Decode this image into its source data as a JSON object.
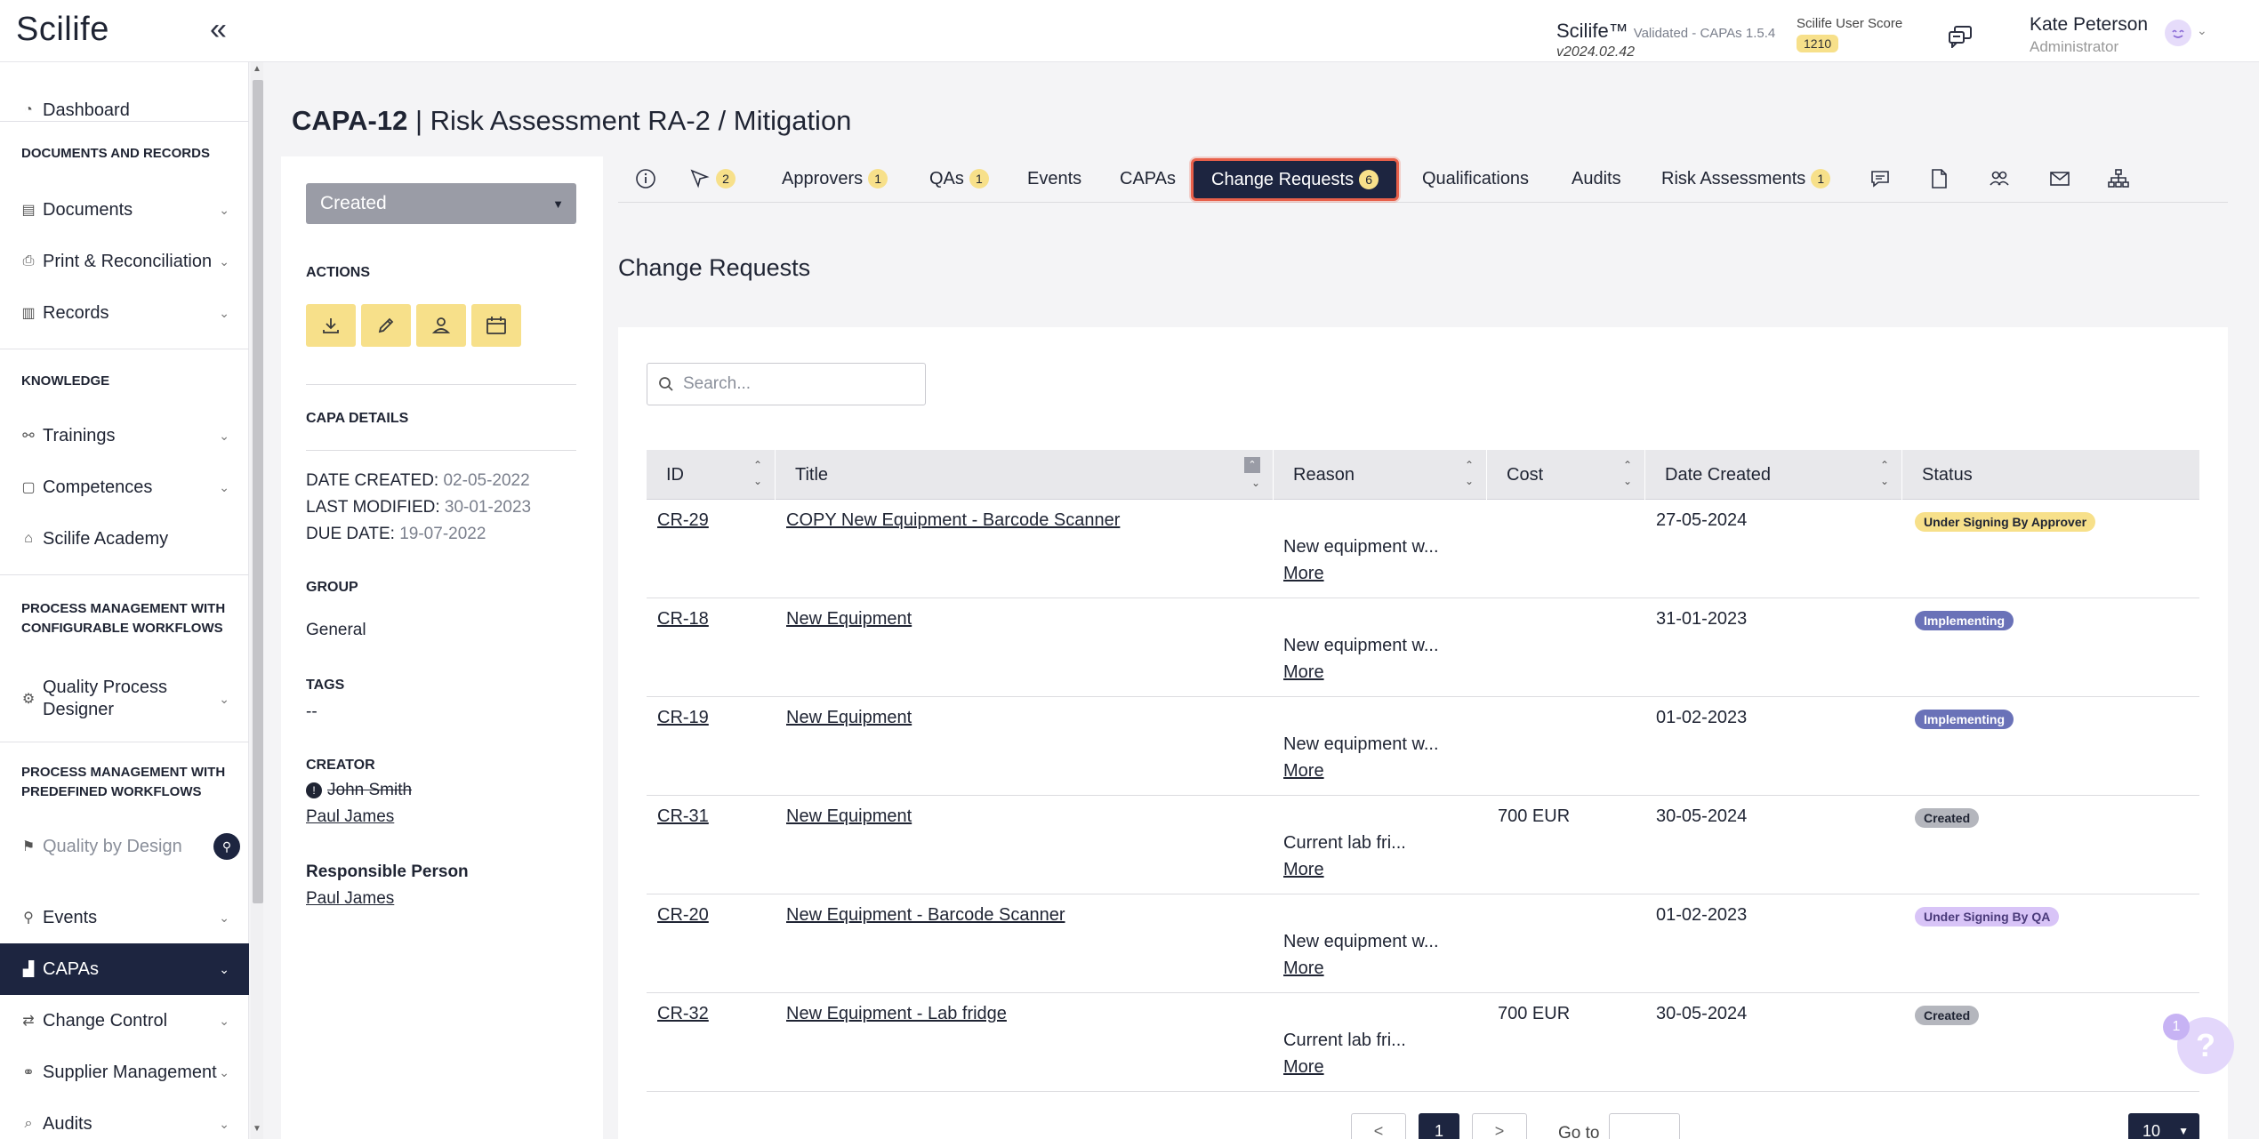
{
  "header": {
    "logo": "Scilife",
    "collapse_icon": "double-chevron-left-icon",
    "app_name": "Scilife™",
    "app_validated": "Validated - CAPAs 1.5.4",
    "app_version": "v2024.02.42",
    "score_label": "Scilife User Score",
    "score_value": "1210",
    "chat_icon": "chat-icon",
    "user_name": "Kate Peterson",
    "user_role": "Administrator"
  },
  "sidebar": {
    "dashboard": "Dashboard",
    "section_docs": "DOCUMENTS AND RECORDS",
    "documents": "Documents",
    "print_reconciliation": "Print & Reconciliation",
    "records": "Records",
    "section_knowledge": "KNOWLEDGE",
    "trainings": "Trainings",
    "competences": "Competences",
    "academy": "Scilife Academy",
    "section_configurable": "PROCESS MANAGEMENT WITH CONFIGURABLE WORKFLOWS",
    "quality_process_designer": "Quality Process Designer",
    "section_predefined": "PROCESS MANAGEMENT WITH PREDEFINED WORKFLOWS",
    "quality_by_design": "Quality by Design",
    "events": "Events",
    "capas": "CAPAs",
    "change_control": "Change Control",
    "supplier_management": "Supplier Management",
    "audits": "Audits"
  },
  "page": {
    "title_id": "CAPA-12",
    "title_sep": "|",
    "title_rest": "Risk Assessment RA-2 / Mitigation"
  },
  "details": {
    "status": "Created",
    "actions_label": "ACTIONS",
    "capa_details_label": "CAPA DETAILS",
    "date_created_label": "DATE CREATED:",
    "date_created": "02-05-2022",
    "last_modified_label": "LAST MODIFIED:",
    "last_modified": "30-01-2023",
    "due_date_label": "DUE DATE:",
    "due_date": "19-07-2022",
    "group_label": "GROUP",
    "group": "General",
    "tags_label": "TAGS",
    "tags": "--",
    "creator_label": "CREATOR",
    "creator_old": "John Smith",
    "creator_new": "Paul James",
    "responsible_label": "Responsible Person",
    "responsible": "Paul James"
  },
  "tabs": {
    "signers_count": "2",
    "approvers": "Approvers",
    "approvers_count": "1",
    "qas": "QAs",
    "qas_count": "1",
    "events": "Events",
    "capas": "CAPAs",
    "change_requests": "Change Requests",
    "change_requests_count": "6",
    "qualifications": "Qualifications",
    "audits": "Audits",
    "risk_assessments": "Risk Assessments",
    "risk_assessments_count": "1"
  },
  "section": {
    "title": "Change Requests",
    "search_placeholder": "Search..."
  },
  "table": {
    "columns": [
      "ID",
      "Title",
      "Reason",
      "Cost",
      "Date Created",
      "Status"
    ],
    "rows": [
      {
        "id": "CR-29",
        "title": "COPY New Equipment - Barcode Scanner",
        "reason": "New equipment w...",
        "more": "More",
        "cost": "",
        "date": "27-05-2024",
        "status": "Under Signing By Approver"
      },
      {
        "id": "CR-18",
        "title": "New Equipment",
        "reason": "New equipment w...",
        "more": "More",
        "cost": "",
        "date": "31-01-2023",
        "status": "Implementing"
      },
      {
        "id": "CR-19",
        "title": "New Equipment",
        "reason": "New equipment w...",
        "more": "More",
        "cost": "",
        "date": "01-02-2023",
        "status": "Implementing"
      },
      {
        "id": "CR-31",
        "title": "New Equipment",
        "reason": "Current lab fri...",
        "more": "More",
        "cost": "700 EUR",
        "date": "30-05-2024",
        "status": "Created"
      },
      {
        "id": "CR-20",
        "title": "New Equipment - Barcode Scanner",
        "reason": "New equipment w...",
        "more": "More",
        "cost": "",
        "date": "01-02-2023",
        "status": "Under Signing By QA"
      },
      {
        "id": "CR-32",
        "title": "New Equipment - Lab fridge",
        "reason": "Current lab fri...",
        "more": "More",
        "cost": "700 EUR",
        "date": "30-05-2024",
        "status": "Created"
      }
    ]
  },
  "pagination": {
    "prev": "<",
    "current": "1",
    "next": ">",
    "goto_label": "Go to",
    "page_size": "10"
  },
  "help": {
    "count": "1",
    "icon": "?"
  },
  "colors": {
    "navy": "#1d2540",
    "accent_yellow": "#f7e08a",
    "tab_highlight": "#e8604a",
    "badge_approver": "#f7e08a",
    "badge_implementing": "#6a72b8",
    "badge_created": "#b4b6bd",
    "badge_qa": "#d8c4f7"
  }
}
